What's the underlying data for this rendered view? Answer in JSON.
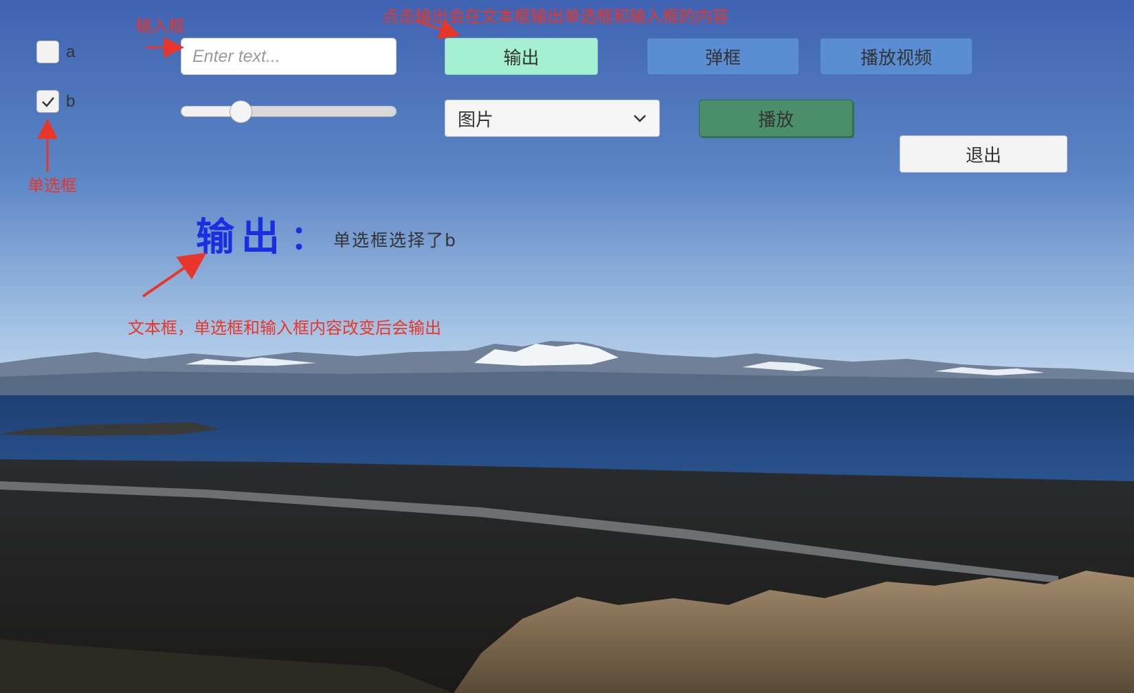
{
  "toggles": [
    {
      "label": "a",
      "checked": false
    },
    {
      "label": "b",
      "checked": true
    }
  ],
  "input": {
    "placeholder": "Enter text...",
    "value": ""
  },
  "slider": {
    "value": 0.25
  },
  "buttons": {
    "output": "输出",
    "popup": "弹框",
    "play_video": "播放视频",
    "play": "播放",
    "exit": "退出"
  },
  "dropdown": {
    "selected": "图片",
    "icon": "chevron-down-icon"
  },
  "output_panel": {
    "label": "输出",
    "colon": "：",
    "text": "单选框选择了b"
  },
  "annotations": {
    "input_box": "输入框",
    "radio_box": "单选框",
    "output_button_hint": "点击输出会在文本框输出单选框和输入框的内容",
    "text_box_hint": "文本框，单选框和输入框内容改变后会输出"
  },
  "colors": {
    "annotation": "#e8362a",
    "output_label": "#1a2fe0",
    "button_green_light": "#a5f0d3",
    "button_blue": "#5b8dd4",
    "button_green_dark": "#4b8e6a"
  }
}
